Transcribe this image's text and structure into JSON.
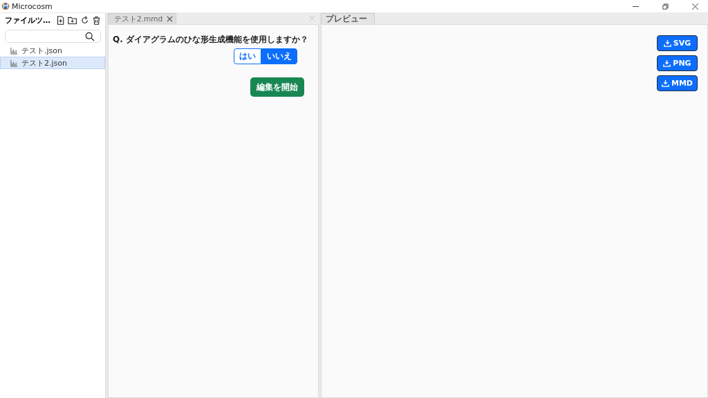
{
  "window": {
    "title": "Microcosm"
  },
  "sidebar": {
    "title": "ファイルツ…",
    "files": [
      {
        "name": "テスト.json",
        "selected": false
      },
      {
        "name": "テスト2.json",
        "selected": true
      }
    ]
  },
  "editor": {
    "tabs": [
      {
        "label": "テスト2.mmd"
      }
    ],
    "question": "Q. ダイアグラムのひな形生成機能を使用しますか？",
    "options": [
      {
        "label": "はい",
        "selected": false
      },
      {
        "label": "いいえ",
        "selected": true
      }
    ],
    "start_button": "編集を開始"
  },
  "preview": {
    "tab": "プレビュー",
    "buttons": [
      "SVG",
      "PNG",
      "MMD"
    ]
  }
}
